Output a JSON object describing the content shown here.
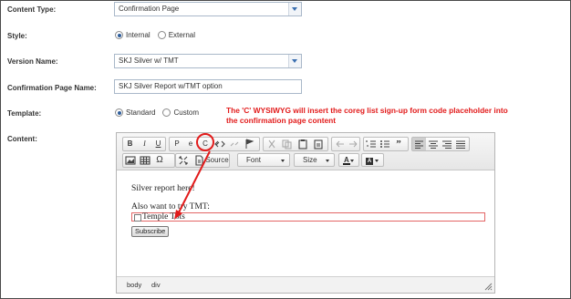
{
  "form": {
    "content_type": {
      "label": "Content Type:",
      "value": "Confirmation Page"
    },
    "style": {
      "label": "Style:",
      "options": [
        "Internal",
        "External"
      ],
      "selected": "Internal"
    },
    "version_name": {
      "label": "Version Name:",
      "value": "SKJ Silver w/ TMT"
    },
    "confirmation_page_name": {
      "label": "Confirmation Page Name:",
      "value": "SKJ Silver Report w/TMT option"
    },
    "template": {
      "label": "Template:",
      "options": [
        "Standard",
        "Custom"
      ],
      "selected": "Standard"
    },
    "content": {
      "label": "Content:"
    }
  },
  "annotation": {
    "text": "The 'C' WYSIWYG will insert the coreg list sign-up form code placeholder into the confirmation page content",
    "color": "#e21b1b"
  },
  "editor": {
    "toolbar": {
      "bold": "B",
      "italic": "I",
      "underline": "U",
      "p": "P",
      "e": "e",
      "c": "C",
      "source": "Source",
      "font": "Font",
      "size": "Size",
      "text_color": "A"
    },
    "content": {
      "line1": "Silver report here!",
      "line2": "Also want to try TMT:",
      "checkbox_label": "Temple Tots",
      "subscribe_label": "Subscribe"
    },
    "path": [
      "body",
      "div"
    ]
  }
}
